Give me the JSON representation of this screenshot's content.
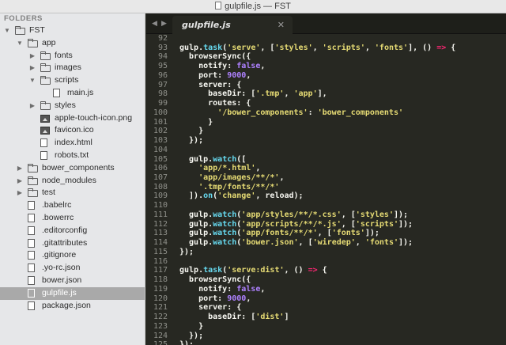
{
  "window": {
    "title": "gulpfile.js — FST"
  },
  "sidebar": {
    "header": "FOLDERS",
    "tree": [
      {
        "label": "FST",
        "kind": "folder-open",
        "depth": 0,
        "expanded": true
      },
      {
        "label": "app",
        "kind": "folder-open",
        "depth": 1,
        "expanded": true
      },
      {
        "label": "fonts",
        "kind": "folder",
        "depth": 2,
        "expanded": false
      },
      {
        "label": "images",
        "kind": "folder",
        "depth": 2,
        "expanded": false
      },
      {
        "label": "scripts",
        "kind": "folder-open",
        "depth": 2,
        "expanded": true
      },
      {
        "label": "main.js",
        "kind": "file",
        "depth": 3
      },
      {
        "label": "styles",
        "kind": "folder",
        "depth": 2,
        "expanded": false
      },
      {
        "label": "apple-touch-icon.png",
        "kind": "image",
        "depth": 2
      },
      {
        "label": "favicon.ico",
        "kind": "image",
        "depth": 2
      },
      {
        "label": "index.html",
        "kind": "file",
        "depth": 2
      },
      {
        "label": "robots.txt",
        "kind": "file",
        "depth": 2
      },
      {
        "label": "bower_components",
        "kind": "folder",
        "depth": 1,
        "expanded": false
      },
      {
        "label": "node_modules",
        "kind": "folder",
        "depth": 1,
        "expanded": false
      },
      {
        "label": "test",
        "kind": "folder",
        "depth": 1,
        "expanded": false
      },
      {
        "label": ".babelrc",
        "kind": "file",
        "depth": 1
      },
      {
        "label": ".bowerrc",
        "kind": "file",
        "depth": 1
      },
      {
        "label": ".editorconfig",
        "kind": "file",
        "depth": 1
      },
      {
        "label": ".gitattributes",
        "kind": "file",
        "depth": 1
      },
      {
        "label": ".gitignore",
        "kind": "file",
        "depth": 1
      },
      {
        "label": ".yo-rc.json",
        "kind": "file",
        "depth": 1
      },
      {
        "label": "bower.json",
        "kind": "file",
        "depth": 1
      },
      {
        "label": "gulpfile.js",
        "kind": "file",
        "depth": 1,
        "selected": true
      },
      {
        "label": "package.json",
        "kind": "file",
        "depth": 1
      }
    ]
  },
  "tabbar": {
    "prev_icon": "◀",
    "next_icon": "▶",
    "tabs": [
      {
        "label": "gulpfile.js",
        "close_icon": "✕",
        "active": true
      }
    ]
  },
  "editor": {
    "theme": {
      "background": "#272822",
      "text": "#f8f8f2",
      "keyword": "#f92672",
      "string": "#e6db74",
      "number": "#ae81ff",
      "function": "#66d9ef",
      "gutter": "#8f908a"
    },
    "lines": [
      {
        "n": 92,
        "segs": []
      },
      {
        "n": 93,
        "segs": [
          [
            "p",
            "gulp."
          ],
          [
            "f",
            "task"
          ],
          [
            "p",
            "("
          ],
          [
            "s",
            "'serve'"
          ],
          [
            "p",
            ", ["
          ],
          [
            "s",
            "'styles'"
          ],
          [
            "p",
            ", "
          ],
          [
            "s",
            "'scripts'"
          ],
          [
            "p",
            ", "
          ],
          [
            "s",
            "'fonts'"
          ],
          [
            "p",
            "], () "
          ],
          [
            "k",
            "=>"
          ],
          [
            "p",
            " {"
          ]
        ]
      },
      {
        "n": 94,
        "segs": [
          [
            "p",
            "  browserSync({"
          ]
        ]
      },
      {
        "n": 95,
        "segs": [
          [
            "p",
            "    notify: "
          ],
          [
            "n",
            "false"
          ],
          [
            "p",
            ","
          ]
        ]
      },
      {
        "n": 96,
        "segs": [
          [
            "p",
            "    port: "
          ],
          [
            "n",
            "9000"
          ],
          [
            "p",
            ","
          ]
        ]
      },
      {
        "n": 97,
        "segs": [
          [
            "p",
            "    server: {"
          ]
        ]
      },
      {
        "n": 98,
        "segs": [
          [
            "p",
            "      baseDir: ["
          ],
          [
            "s",
            "'.tmp'"
          ],
          [
            "p",
            ", "
          ],
          [
            "s",
            "'app'"
          ],
          [
            "p",
            "],"
          ]
        ]
      },
      {
        "n": 99,
        "segs": [
          [
            "p",
            "      routes: {"
          ]
        ]
      },
      {
        "n": 100,
        "segs": [
          [
            "p",
            "        "
          ],
          [
            "s",
            "'/bower_components'"
          ],
          [
            "p",
            ": "
          ],
          [
            "s",
            "'bower_components'"
          ]
        ]
      },
      {
        "n": 101,
        "segs": [
          [
            "p",
            "      }"
          ]
        ]
      },
      {
        "n": 102,
        "segs": [
          [
            "p",
            "    }"
          ]
        ]
      },
      {
        "n": 103,
        "segs": [
          [
            "p",
            "  });"
          ]
        ]
      },
      {
        "n": 104,
        "segs": []
      },
      {
        "n": 105,
        "segs": [
          [
            "p",
            "  gulp."
          ],
          [
            "f",
            "watch"
          ],
          [
            "p",
            "(["
          ]
        ]
      },
      {
        "n": 106,
        "segs": [
          [
            "p",
            "    "
          ],
          [
            "s",
            "'app/*.html'"
          ],
          [
            "p",
            ","
          ]
        ]
      },
      {
        "n": 107,
        "segs": [
          [
            "p",
            "    "
          ],
          [
            "s",
            "'app/images/**/*'"
          ],
          [
            "p",
            ","
          ]
        ]
      },
      {
        "n": 108,
        "segs": [
          [
            "p",
            "    "
          ],
          [
            "s",
            "'.tmp/fonts/**/*'"
          ]
        ]
      },
      {
        "n": 109,
        "segs": [
          [
            "p",
            "  ])."
          ],
          [
            "f",
            "on"
          ],
          [
            "p",
            "("
          ],
          [
            "s",
            "'change'"
          ],
          [
            "p",
            ", reload);"
          ]
        ]
      },
      {
        "n": 110,
        "segs": []
      },
      {
        "n": 111,
        "segs": [
          [
            "p",
            "  gulp."
          ],
          [
            "f",
            "watch"
          ],
          [
            "p",
            "("
          ],
          [
            "s",
            "'app/styles/**/*.css'"
          ],
          [
            "p",
            ", ["
          ],
          [
            "s",
            "'styles'"
          ],
          [
            "p",
            "]);"
          ]
        ]
      },
      {
        "n": 112,
        "segs": [
          [
            "p",
            "  gulp."
          ],
          [
            "f",
            "watch"
          ],
          [
            "p",
            "("
          ],
          [
            "s",
            "'app/scripts/**/*.js'"
          ],
          [
            "p",
            ", ["
          ],
          [
            "s",
            "'scripts'"
          ],
          [
            "p",
            "]);"
          ]
        ]
      },
      {
        "n": 113,
        "segs": [
          [
            "p",
            "  gulp."
          ],
          [
            "f",
            "watch"
          ],
          [
            "p",
            "("
          ],
          [
            "s",
            "'app/fonts/**/*'"
          ],
          [
            "p",
            ", ["
          ],
          [
            "s",
            "'fonts'"
          ],
          [
            "p",
            "]);"
          ]
        ]
      },
      {
        "n": 114,
        "segs": [
          [
            "p",
            "  gulp."
          ],
          [
            "f",
            "watch"
          ],
          [
            "p",
            "("
          ],
          [
            "s",
            "'bower.json'"
          ],
          [
            "p",
            ", ["
          ],
          [
            "s",
            "'wiredep'"
          ],
          [
            "p",
            ", "
          ],
          [
            "s",
            "'fonts'"
          ],
          [
            "p",
            "]);"
          ]
        ]
      },
      {
        "n": 115,
        "segs": [
          [
            "p",
            "});"
          ]
        ]
      },
      {
        "n": 116,
        "segs": []
      },
      {
        "n": 117,
        "segs": [
          [
            "p",
            "gulp."
          ],
          [
            "f",
            "task"
          ],
          [
            "p",
            "("
          ],
          [
            "s",
            "'serve:dist'"
          ],
          [
            "p",
            ", () "
          ],
          [
            "k",
            "=>"
          ],
          [
            "p",
            " {"
          ]
        ]
      },
      {
        "n": 118,
        "segs": [
          [
            "p",
            "  browserSync({"
          ]
        ]
      },
      {
        "n": 119,
        "segs": [
          [
            "p",
            "    notify: "
          ],
          [
            "n",
            "false"
          ],
          [
            "p",
            ","
          ]
        ]
      },
      {
        "n": 120,
        "segs": [
          [
            "p",
            "    port: "
          ],
          [
            "n",
            "9000"
          ],
          [
            "p",
            ","
          ]
        ]
      },
      {
        "n": 121,
        "segs": [
          [
            "p",
            "    server: {"
          ]
        ]
      },
      {
        "n": 122,
        "segs": [
          [
            "p",
            "      baseDir: ["
          ],
          [
            "s",
            "'dist'"
          ],
          [
            "p",
            "]"
          ]
        ]
      },
      {
        "n": 123,
        "segs": [
          [
            "p",
            "    }"
          ]
        ]
      },
      {
        "n": 124,
        "segs": [
          [
            "p",
            "  });"
          ]
        ]
      },
      {
        "n": 125,
        "segs": [
          [
            "p",
            "});"
          ]
        ]
      }
    ]
  }
}
